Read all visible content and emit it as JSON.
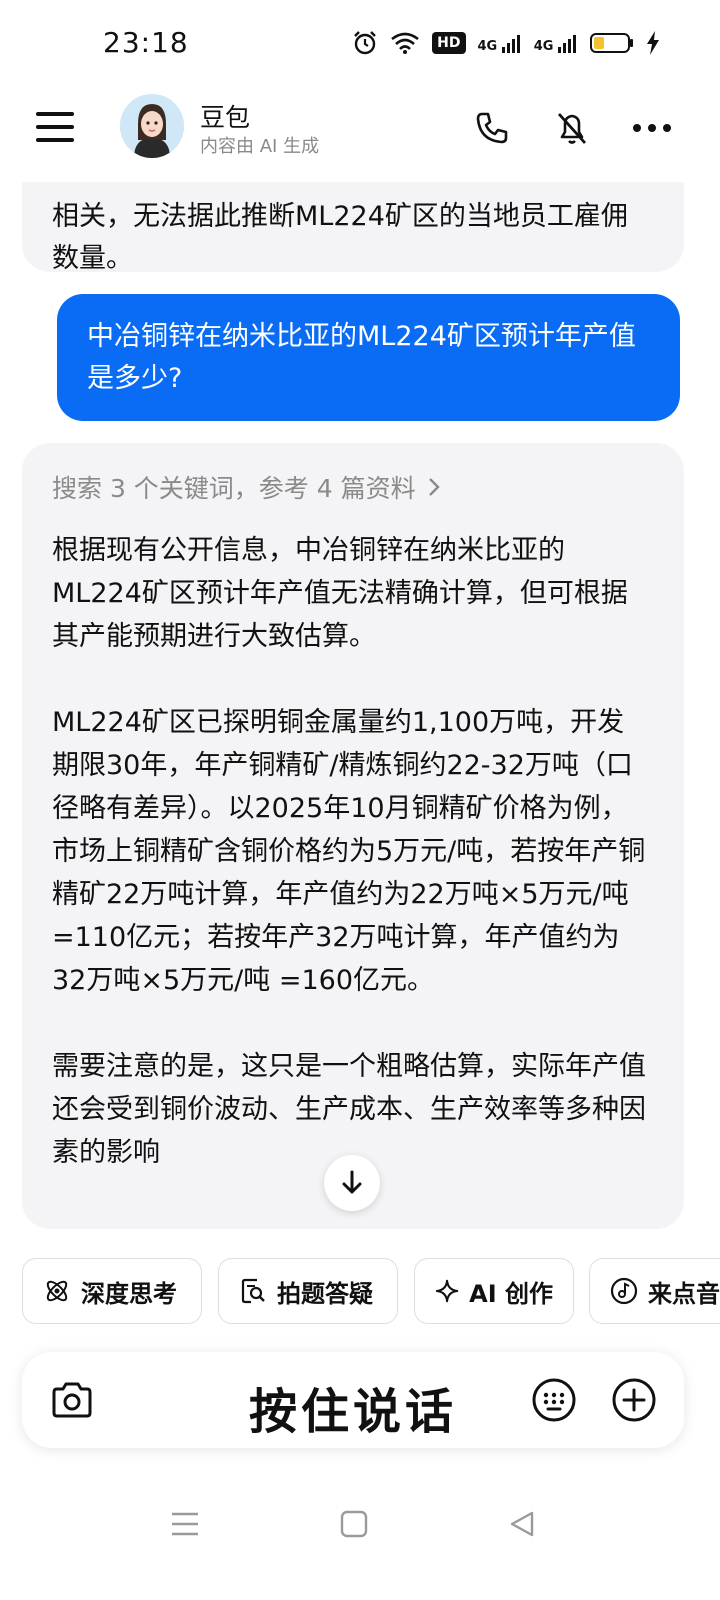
{
  "status_bar": {
    "time": "23:18",
    "icons": [
      "alarm-icon",
      "wifi-icon",
      "hd-badge",
      "signal-4g-icon",
      "signal-4g-icon",
      "battery-icon",
      "charging-icon"
    ],
    "hd_label": "HD",
    "net_label_1": "4G",
    "net_label_2": "4G"
  },
  "header": {
    "title": "豆包",
    "subtitle": "内容由 AI 生成",
    "icons": [
      "menu-icon",
      "phone-icon",
      "mute-icon",
      "more-icon"
    ]
  },
  "messages": {
    "prev_ai_tail": "相关，无法据此推断ML224矿区的当地员工雇佣数量。",
    "user": "中冶铜锌在纳米比亚的ML224矿区预计年产值是多少?",
    "ai": {
      "search_summary": "搜索 3 个关键词，参考 4 篇资料",
      "paragraph_1": "根据现有公开信息，中冶铜锌在纳米比亚的ML224矿区预计年产值无法精确计算，但可根据其产能预期进行大致估算。",
      "paragraph_2": "ML224矿区已探明铜金属量约1,100万吨，开发期限30年，年产铜精矿/精炼铜约22-32万吨（口径略有差异）。以2025年10月铜精矿价格为例，市场上铜精矿含铜价格约为5万元/吨，若按年产铜精矿22万吨计算，年产值约为22万吨×5万元/吨 =110亿元；若按年产32万吨计算，年产值约为32万吨×5万元/吨 =160亿元。",
      "paragraph_3": "需要注意的是，这只是一个粗略估算，实际年产值还会受到铜价波动、生产成本、生产效率等多种因素的影响"
    }
  },
  "chips": [
    {
      "label": "深度思考",
      "icon": "atom-icon"
    },
    {
      "label": "拍题答疑",
      "icon": "photo-search-icon"
    },
    {
      "label": "AI 创作",
      "icon": "sparkle-icon"
    },
    {
      "label": "来点音乐",
      "icon": "music-icon"
    }
  ],
  "input_bar": {
    "hold_to_talk": "按住说话",
    "icons": [
      "camera-icon",
      "keyboard-icon",
      "plus-icon"
    ]
  },
  "nav_bar": {
    "icons": [
      "recents-icon",
      "home-icon",
      "back-icon"
    ]
  }
}
